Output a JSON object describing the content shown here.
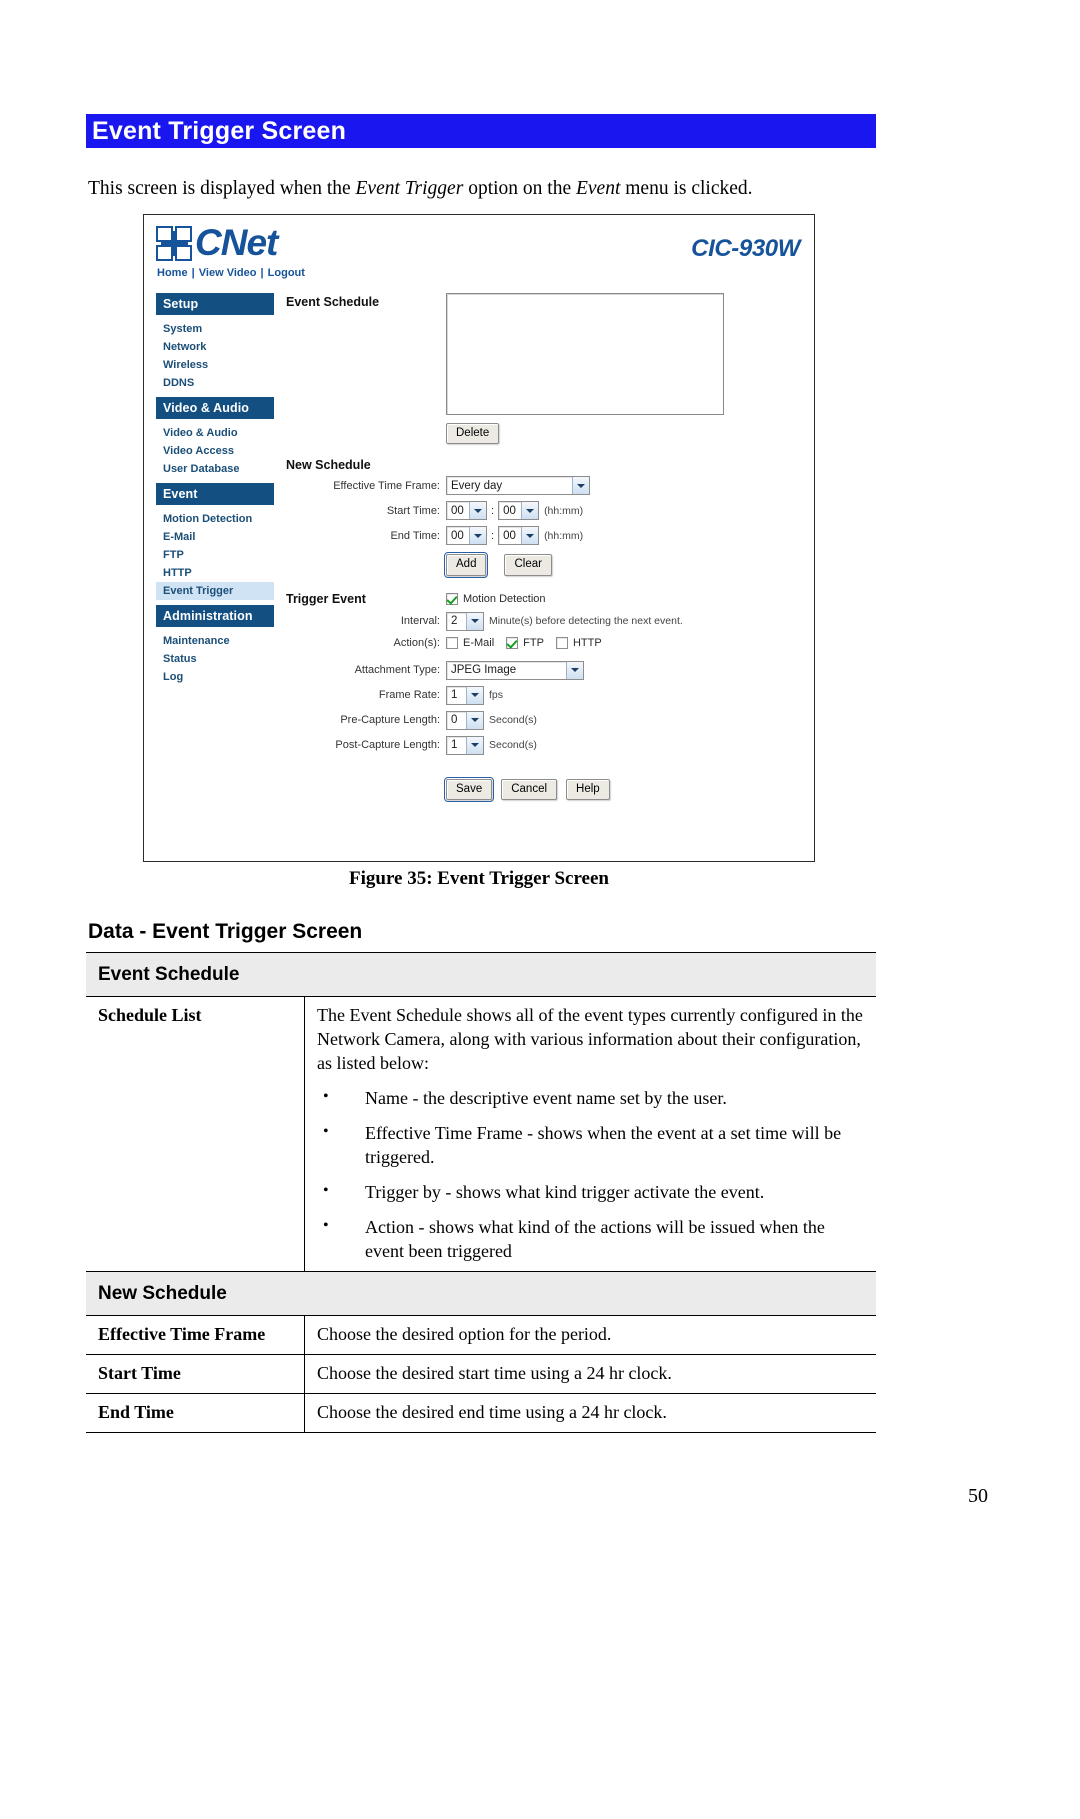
{
  "document": {
    "banner_title": "Event Trigger Screen",
    "intro_prefix": "This screen is displayed when the ",
    "intro_em1": "Event Trigger",
    "intro_mid": " option on the ",
    "intro_em2": "Event",
    "intro_suffix": " menu is clicked.",
    "figure_caption": "Figure 35: Event Trigger Screen",
    "data_title": "Data - Event Trigger Screen",
    "page_number": "50",
    "banner_color": "#1a16ef"
  },
  "ui": {
    "brand": "CNet",
    "model": "CIC-930W",
    "brand_color": "#16539a",
    "top_links": [
      {
        "label": "Home"
      },
      {
        "label": "View Video"
      },
      {
        "label": "Logout"
      }
    ],
    "sidebar": {
      "sections": [
        {
          "title": "Setup",
          "items": [
            {
              "label": "System",
              "active": false
            },
            {
              "label": "Network",
              "active": false
            },
            {
              "label": "Wireless",
              "active": false
            },
            {
              "label": "DDNS",
              "active": false
            }
          ]
        },
        {
          "title": "Video & Audio",
          "items": [
            {
              "label": "Video & Audio",
              "active": false
            },
            {
              "label": "Video Access",
              "active": false
            },
            {
              "label": "User Database",
              "active": false
            }
          ]
        },
        {
          "title": "Event",
          "items": [
            {
              "label": "Motion Detection",
              "active": false
            },
            {
              "label": "E-Mail",
              "active": false
            },
            {
              "label": "FTP",
              "active": false
            },
            {
              "label": "HTTP",
              "active": false
            },
            {
              "label": "Event Trigger",
              "active": true
            }
          ]
        },
        {
          "title": "Administration",
          "items": [
            {
              "label": "Maintenance",
              "active": false
            },
            {
              "label": "Status",
              "active": false
            },
            {
              "label": "Log",
              "active": false
            }
          ]
        }
      ]
    },
    "event_schedule": {
      "heading": "Event Schedule",
      "list_items": [],
      "delete_button": "Delete"
    },
    "new_schedule": {
      "heading": "New Schedule",
      "effective_time_frame_label": "Effective Time Frame:",
      "effective_time_frame_value": "Every day",
      "start_time_label": "Start Time:",
      "start_time_hour": "00",
      "start_time_minute": "00",
      "start_time_hint": "(hh:mm)",
      "end_time_label": "End Time:",
      "end_time_hour": "00",
      "end_time_minute": "00",
      "end_time_hint": "(hh:mm)",
      "add_button": "Add",
      "clear_button": "Clear"
    },
    "trigger_event": {
      "heading": "Trigger Event",
      "motion_detection_label": "Motion Detection",
      "motion_detection_checked": true,
      "interval_label": "Interval:",
      "interval_value": "2",
      "interval_hint": "Minute(s) before detecting the next event.",
      "actions_label": "Action(s):",
      "actions": [
        {
          "label": "E-Mail",
          "checked": false
        },
        {
          "label": "FTP",
          "checked": true
        },
        {
          "label": "HTTP",
          "checked": false
        }
      ],
      "attachment_type_label": "Attachment Type:",
      "attachment_type_value": "JPEG Image",
      "frame_rate_label": "Frame Rate:",
      "frame_rate_value": "1",
      "frame_rate_unit": "fps",
      "pre_capture_label": "Pre-Capture Length:",
      "pre_capture_value": "0",
      "pre_capture_unit": "Second(s)",
      "post_capture_label": "Post-Capture Length:",
      "post_capture_value": "1",
      "post_capture_unit": "Second(s)"
    },
    "buttons": {
      "save": "Save",
      "cancel": "Cancel",
      "help": "Help"
    }
  },
  "data_table": {
    "rows": [
      {
        "type": "group",
        "label": "Event Schedule"
      },
      {
        "type": "entry",
        "key": "Schedule List",
        "value": "The Event Schedule shows all of the event types currently configured in the Network Camera, along with various information about their configuration, as listed below:",
        "bullets": [
          "Name - the descriptive event name set by the user.",
          " Effective Time Frame - shows when the event at a set time will be triggered.",
          " Trigger by - shows what kind trigger activate the event.",
          " Action - shows what kind of the actions will be issued when the event been triggered"
        ]
      },
      {
        "type": "group",
        "label": "New Schedule"
      },
      {
        "type": "entry",
        "key": "Effective Time Frame",
        "value": "Choose the desired option for the period.",
        "bullets": []
      },
      {
        "type": "entry",
        "key": "Start Time",
        "value": "Choose the desired start time using a 24 hr clock.",
        "bullets": []
      },
      {
        "type": "entry",
        "key": "End Time",
        "value": "Choose the desired end time using a 24 hr clock.",
        "bullets": []
      }
    ]
  }
}
